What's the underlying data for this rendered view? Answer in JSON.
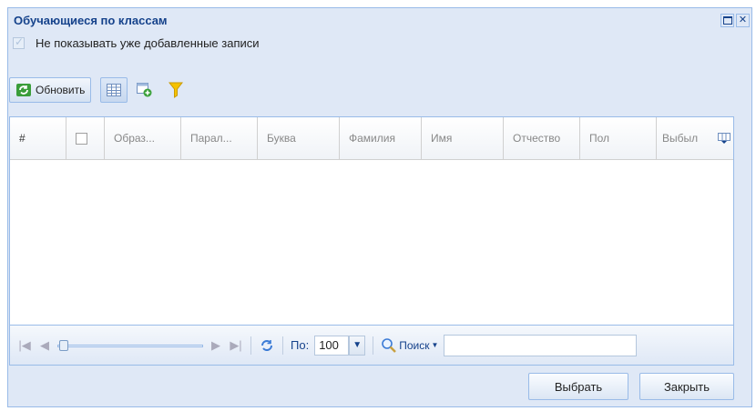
{
  "window": {
    "title": "Обучающиеся по классам"
  },
  "checkbox": {
    "label": "Не показывать уже добавленные записи",
    "checked": true
  },
  "toolbar": {
    "refresh_label": "Обновить"
  },
  "grid": {
    "columns": [
      "#",
      "",
      "Образ...",
      "Парал...",
      "Буква",
      "Фамилия",
      "Имя",
      "Отчество",
      "Пол",
      "Выбыл"
    ]
  },
  "pager": {
    "per_page_label": "По:",
    "per_page_value": "100",
    "search_label": "Поиск"
  },
  "footer": {
    "select_label": "Выбрать",
    "close_label": "Закрыть"
  }
}
